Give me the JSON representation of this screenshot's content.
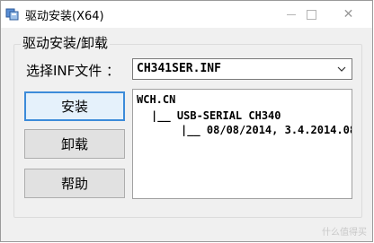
{
  "window": {
    "title": "驱动安装(X64)",
    "controls": {
      "minimize": "minimize",
      "maximize": "maximize",
      "close": "✕"
    }
  },
  "group": {
    "title": "驱动安装/卸载",
    "inf_label": "选择INF文件 ：",
    "inf_selected": "CH341SER.INF"
  },
  "buttons": {
    "install": "安装",
    "uninstall": "卸载",
    "help": "帮助"
  },
  "info": {
    "lines": [
      "WCH.CN",
      "|__ USB-SERIAL CH340",
      "|__ 08/08/2014, 3.4.2014.08"
    ]
  },
  "watermark": "什么值得买",
  "colors": {
    "accent": "#3c8bd9",
    "window_bg": "#f0f0f0"
  }
}
